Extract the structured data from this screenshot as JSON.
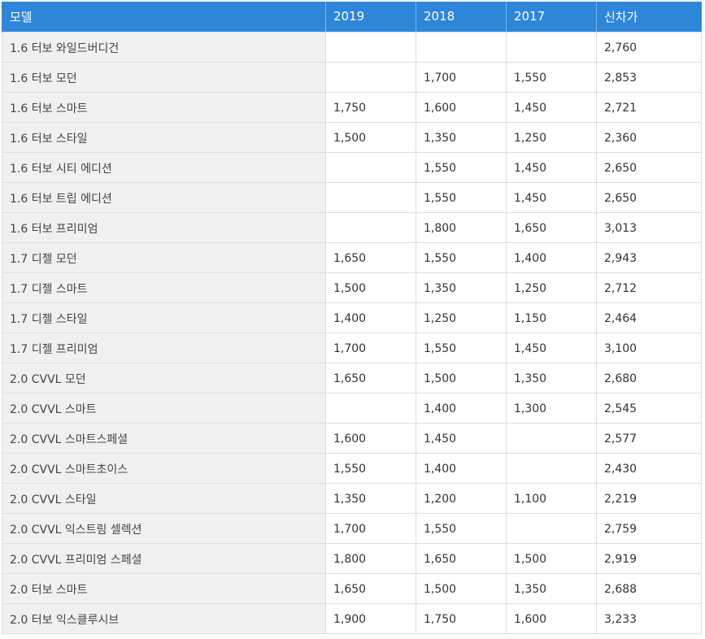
{
  "table": {
    "headers": [
      "모델",
      "2019",
      "2018",
      "2017",
      "신차가"
    ],
    "rows": [
      [
        "1.6 터보 와일드버디건",
        "",
        "",
        "",
        "2,760"
      ],
      [
        "1.6 터보 모던",
        "",
        "1,700",
        "1,550",
        "2,853"
      ],
      [
        "1.6 터보 스마트",
        "1,750",
        "1,600",
        "1,450",
        "2,721"
      ],
      [
        "1.6 터보 스타일",
        "1,500",
        "1,350",
        "1,250",
        "2,360"
      ],
      [
        "1.6 터보 시티 에디션",
        "",
        "1,550",
        "1,450",
        "2,650"
      ],
      [
        "1.6 터보 트립 에디션",
        "",
        "1,550",
        "1,450",
        "2,650"
      ],
      [
        "1.6 터보 프리미엄",
        "",
        "1,800",
        "1,650",
        "3,013"
      ],
      [
        "1.7 디젤 모던",
        "1,650",
        "1,550",
        "1,400",
        "2,943"
      ],
      [
        "1.7 디젤 스마트",
        "1,500",
        "1,350",
        "1,250",
        "2,712"
      ],
      [
        "1.7 디젤 스타일",
        "1,400",
        "1,250",
        "1,150",
        "2,464"
      ],
      [
        "1.7 디젤 프리미엄",
        "1,700",
        "1,550",
        "1,450",
        "3,100"
      ],
      [
        "2.0 CVVL 모던",
        "1,650",
        "1,500",
        "1,350",
        "2,680"
      ],
      [
        "2.0 CVVL 스마트",
        "",
        "1,400",
        "1,300",
        "2,545"
      ],
      [
        "2.0 CVVL 스마트스페셜",
        "1,600",
        "1,450",
        "",
        "2,577"
      ],
      [
        "2.0 CVVL 스마트초이스",
        "1,550",
        "1,400",
        "",
        "2,430"
      ],
      [
        "2.0 CVVL 스타일",
        "1,350",
        "1,200",
        "1,100",
        "2,219"
      ],
      [
        "2.0 CVVL 익스트림 셀렉션",
        "1,700",
        "1,550",
        "",
        "2,759"
      ],
      [
        "2.0 CVVL 프리미엄 스페셜",
        "1,800",
        "1,650",
        "1,500",
        "2,919"
      ],
      [
        "2.0 터보 스마트",
        "1,650",
        "1,500",
        "1,350",
        "2,688"
      ],
      [
        "2.0 터보 익스클루시브",
        "1,900",
        "1,750",
        "1,600",
        "3,233"
      ]
    ]
  },
  "colors": {
    "header_bg": "#2e86d9",
    "model_cell_bg": "#f0f0f0",
    "border": "#dddddd"
  }
}
